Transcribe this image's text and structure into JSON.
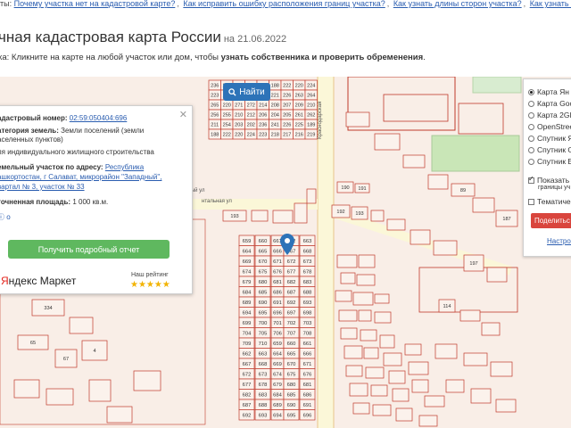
{
  "faq": {
    "prefix": "ты:",
    "links": [
      "Почему участка нет на кадастровой карте?",
      "Как исправить ошибку расположения границ участка?",
      "Как узнать длины сторон участка?",
      "Как узнать ФИО собственника у"
    ]
  },
  "page": {
    "title": "чная кадастровая карта России",
    "date": "на 21.06.2022",
    "hint_prefix": "ка: Кликните на карте на любой участок или дом, чтобы ",
    "hint_bold": "узнать собственника и проверить обременения",
    "hint_suffix": "."
  },
  "search": {
    "label": "Найти",
    "icon": "search-icon"
  },
  "popup": {
    "cadastral_label": "адастровый номер:",
    "cadastral_value": "02:59:050404:696",
    "category_label": "атегория земель:",
    "category_value": "Земли поселений (земли",
    "category_value2": "аселенных пунктов)",
    "use_value": "ля индивидуального жилищного строительства",
    "address_label": "емельный участок по адресу:",
    "address_line1": "Республика",
    "address_line2": "ашкортостан, г Салават, микрорайон \"Западный\",",
    "address_line3": "вартал № 3, участок № 33",
    "area_label": "точненная площадь:",
    "area_value": "1 000 кв.м.",
    "help_link": "о",
    "report_button": "Получить подробный отчет",
    "market_logo_red": "Я",
    "market_logo_rest": "ндекс Маркет",
    "rating_label": "Наш рейтинг",
    "rating_stars": "★★★★★"
  },
  "layers": {
    "options": [
      {
        "label": "Карта Ян",
        "selected": true
      },
      {
        "label": "Карта Goo",
        "selected": false
      },
      {
        "label": "Карта 2Gl",
        "selected": false
      },
      {
        "label": "OpenStree",
        "selected": false
      },
      {
        "label": "Спутник Я",
        "selected": false
      },
      {
        "label": "Спутник G",
        "selected": false
      },
      {
        "label": "Спутник E",
        "selected": false
      }
    ],
    "show_borders_line1": "Показать ка",
    "show_borders_line2": "границы уч",
    "thematic_label": "Тематичес",
    "share_button": "Поделитьс",
    "settings_link": "Настрои"
  },
  "map": {
    "street_left": "Садовый ул",
    "street_left2": "нтальная ул",
    "street_vertical": "Краснодарская",
    "plot_labels_top": [
      "236",
      "241",
      "226",
      "225",
      "189",
      "188",
      "222",
      "220",
      "224",
      "223",
      "218",
      "217",
      "216",
      "219",
      "221",
      "226",
      "263",
      "264",
      "265",
      "220",
      "271",
      "272",
      "214",
      "208",
      "207",
      "209",
      "210",
      "256",
      "255",
      "210",
      "212",
      "206",
      "204",
      "205",
      "261",
      "262",
      "211",
      "254",
      "203",
      "202"
    ],
    "plot_numbers_main": [
      "659",
      "660",
      "661",
      "662",
      "663",
      "664",
      "665",
      "666",
      "667",
      "668",
      "669",
      "670",
      "671",
      "672",
      "673",
      "674",
      "675",
      "676",
      "677",
      "678",
      "679",
      "680",
      "681",
      "682",
      "683",
      "684",
      "685",
      "686",
      "687",
      "688",
      "689",
      "690",
      "691",
      "692",
      "693",
      "694",
      "695",
      "696",
      "697",
      "698",
      "699",
      "700",
      "701",
      "702",
      "703",
      "704",
      "705",
      "706",
      "707",
      "708",
      "709",
      "710"
    ],
    "selected_plot": "683",
    "misc_labels": [
      "190",
      "191",
      "192",
      "193",
      "80",
      "89",
      "187",
      "197",
      "114",
      "334",
      "65",
      "67",
      "4"
    ]
  }
}
